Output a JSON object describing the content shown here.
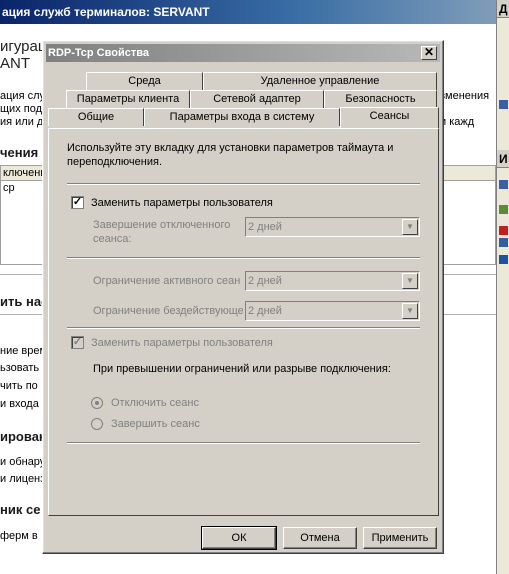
{
  "background_window": {
    "title": "ация служб терминалов: SERVANT",
    "heading": "игурац",
    "subheading": "ANT",
    "desc_lines": [
      "ация служ",
      "щих под",
      "ия или д"
    ],
    "desc_right_lines": [
      "зменения",
      "и кажд"
    ],
    "section_connections": "чения",
    "grid_header": "ключения",
    "grid_row": "ср",
    "section_settings": "ить нас",
    "settings_lines": [
      "ние врем",
      "ьзовать",
      "чить по",
      "и входа п"
    ],
    "section_licensing": "ирован",
    "licensing_lines": [
      "и обнару",
      "и лиценз"
    ],
    "section_source": "ник се",
    "source_line": "ферм в",
    "right_pane_heads": [
      "Д",
      "И"
    ]
  },
  "dialog": {
    "title": "RDP-Tcp Свойства",
    "close_glyph": "✕",
    "tabs_row1": [
      "Среда",
      "Удаленное управление"
    ],
    "tabs_row2": [
      "Параметры клиента",
      "Сетевой адаптер",
      "Безопасность"
    ],
    "tabs_row3": [
      "Общие",
      "Параметры входа в систему",
      "Сеансы"
    ],
    "active_tab": "Сеансы",
    "intro_text_1": "Используйте эту вкладку для установки параметров таймаута и",
    "intro_text_2": "переподключения.",
    "override_user_1": {
      "label": "Заменить параметры пользователя",
      "checked": true
    },
    "end_disconnected_label_1": "Завершение отключенного",
    "end_disconnected_label_2": "сеанса:",
    "end_disconnected_value": "2 дней",
    "active_limit_label": "Ограничение активного сеан",
    "active_limit_value": "2 дней",
    "idle_limit_label": "Ограничение бездействующе",
    "idle_limit_value": "2 дней",
    "override_user_2": {
      "label": "Заменить параметры пользователя",
      "checked": true
    },
    "on_limit_label": "При превышении ограничений или разрыве подключения:",
    "radio_disconnect": "Отключить сеанс",
    "radio_end": "Завершить сеанс",
    "buttons": {
      "ok": "ОК",
      "cancel": "Отмена",
      "apply": "Применить"
    }
  }
}
